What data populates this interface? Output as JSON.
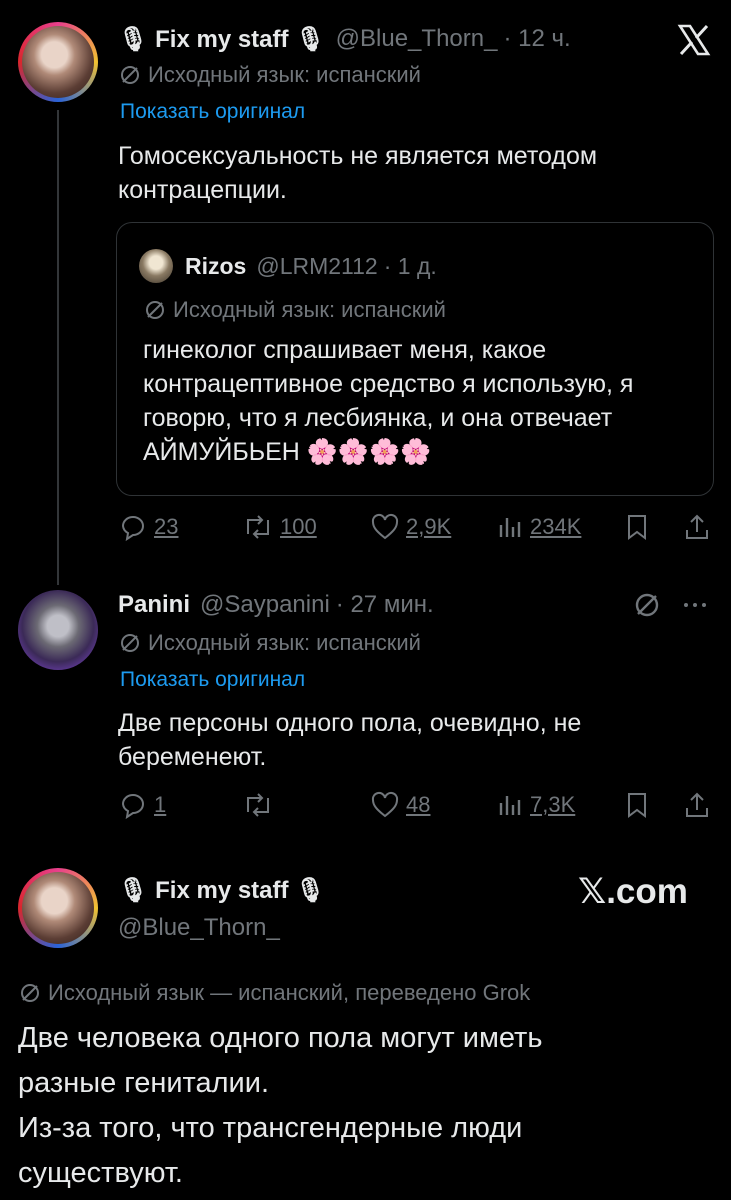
{
  "tweet1": {
    "display_name": "🎙 Fix my staff 🎙",
    "handle": "@Blue_Thorn_",
    "time": "· 12 ч.",
    "translation_note": "Исходный язык: испанский",
    "show_original": "Показать оригинал",
    "text": "Гомосексуальность не является методом контрацепции.",
    "quote": {
      "display_name": "Rizos",
      "handle": "@LRM2112",
      "time": "· 1 д.",
      "translation_note": "Исходный язык: испанский",
      "text": "гинеколог спрашивает меня, какое контрацептивное средство я использую, я говорю, что я лесбиянка, и она отвечает АЙМУЙБЬЕН 🌸🌸🌸🌸"
    },
    "actions": {
      "replies": "23",
      "reposts": "100",
      "likes": "2,9K",
      "views": "234K"
    }
  },
  "tweet2": {
    "display_name": "Panini",
    "handle": "@Saypanini",
    "time": "· 27 мин.",
    "translation_note": "Исходный язык: испанский",
    "show_original": "Показать оригинал",
    "text": "Две персоны одного пола, очевидно, не беременеют.",
    "actions": {
      "replies": "1",
      "reposts": "",
      "likes": "48",
      "views": "7,3K"
    }
  },
  "tweet3": {
    "display_name": "🎙 Fix my staff 🎙",
    "handle": "@Blue_Thorn_",
    "brand": "𝕏.com",
    "translation_note": "Исходный язык — испанский, переведено Grok",
    "text_lines": [
      "Две человека одного пола могут иметь",
      "разные гениталии.",
      "Из-за того, что трансгендерные люди",
      "существуют."
    ]
  },
  "icons": {
    "close": "x-logo-icon",
    "translate": "translate-icon",
    "reply": "reply-icon",
    "repost": "repost-icon",
    "like": "heart-icon",
    "views": "views-icon",
    "bookmark": "bookmark-icon",
    "share": "share-icon",
    "more": "more-icon"
  },
  "colors": {
    "background": "#000000",
    "text": "#e7e9ea",
    "muted": "#71767b",
    "link": "#1d9bf0",
    "border": "#2f3336"
  }
}
